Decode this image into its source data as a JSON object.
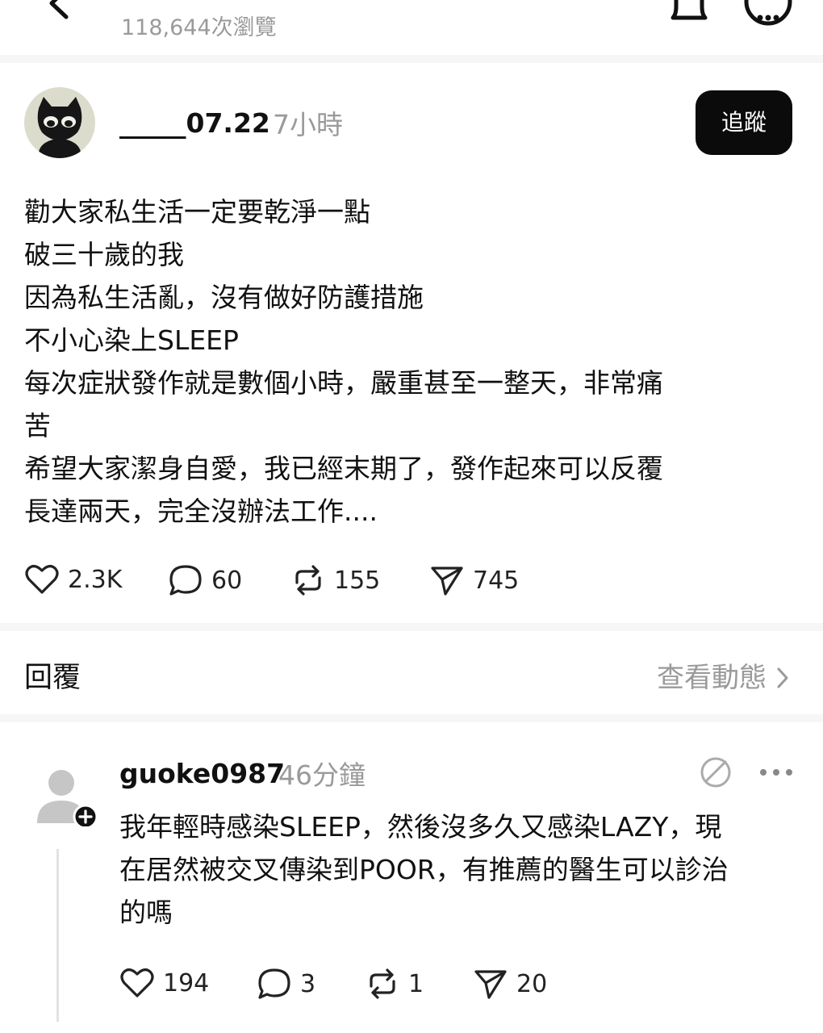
{
  "header": {
    "views": "118,644次瀏覽"
  },
  "post": {
    "username": "_____07.22",
    "time": "7小時",
    "follow_label": "追蹤",
    "lines": [
      "勸大家私生活一定要乾淨一點",
      "破三十歲的我",
      "因為私生活亂，沒有做好防護措施",
      "不小心染上SLEEP",
      "每次症狀發作就是數個小時，嚴重甚至一整天，非常痛",
      "苦",
      "希望大家潔身自愛，我已經末期了，發作起來可以反覆",
      "長達兩天，完全沒辦法工作...."
    ],
    "stats": {
      "likes": "2.3K",
      "comments": "60",
      "reposts": "155",
      "shares": "745"
    }
  },
  "reply_section": {
    "label": "回覆",
    "view_activity": "查看動態"
  },
  "comment": {
    "username": "guoke0987",
    "time": "46分鐘",
    "lines": [
      "我年輕時感染SLEEP，然後沒多久又感染LAZY，現",
      "在居然被交叉傳染到POOR，有推薦的醫生可以診治",
      "的嗎"
    ],
    "stats": {
      "likes": "194",
      "comments": "3",
      "reposts": "1",
      "shares": "20"
    }
  },
  "icons": {
    "back": "back-arrow-icon",
    "bell": "bell-icon",
    "more": "more-options-icon",
    "like": "heart-icon",
    "comment": "comment-bubble-icon",
    "repost": "repost-icon",
    "share": "send-icon",
    "chevron": "chevron-right-icon",
    "translate": "translate-icon",
    "follow_plus": "plus-icon",
    "avatar": "avatar-icon"
  }
}
